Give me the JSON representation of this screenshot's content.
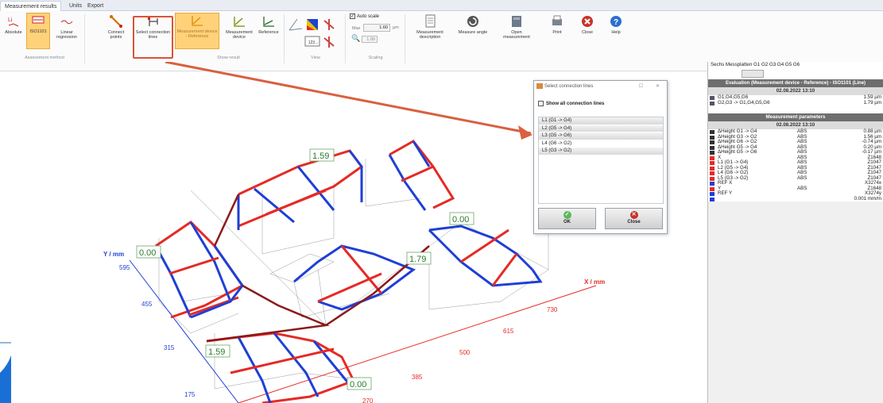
{
  "tabs": [
    "Measurement results",
    "Units",
    "Export"
  ],
  "ribbon": {
    "abs": "Absolute",
    "iso": "ISO1101",
    "linreg": "Linear regression",
    "connect": "Connect points",
    "select": "Select connection lines",
    "md_ref": "Measurement device - Reference",
    "md": "Measurement device",
    "ref": "Reference",
    "num": "123...",
    "autoscale": "Auto scale",
    "max_label": "Max",
    "max_val": "1.60",
    "max_unit": "µm",
    "min_val": "1.00",
    "mdesc": "Measurement description",
    "mangle": "Measure angle",
    "openm": "Open measurement",
    "print": "Print",
    "close": "Close",
    "help": "Help",
    "g_method": "Assessment method",
    "g_show": "Show result",
    "g_view": "View",
    "g_scaling": "Scaling"
  },
  "dialog": {
    "title": "Select connection lines",
    "showall": "Show all connection lines",
    "items": [
      "L1 (G1 -> G4)",
      "L2 (G5 -> G4)",
      "L3 (G5 -> G6)",
      "L4 (G6 -> G2)",
      "L5 (G3 -> G2)"
    ],
    "ok": "OK",
    "close": "Close"
  },
  "panel": {
    "tabs": "Sechs Messplatten  G1   G2   G3   G4   G5   G6",
    "eval_title": "Evaluation (Measurement device - Reference) - ISO1101 (Line)",
    "date": "02.08.2022 13:10",
    "eval_rows": [
      {
        "name": "G1,G4,G5,G6",
        "value": "1.59 µm"
      },
      {
        "name": "G2,G3 -> G1,G4,G5,G6",
        "value": "1.79 µm"
      }
    ],
    "params_title": "Measurement parameters",
    "params_date": "02.08.2022 13:10",
    "params": [
      {
        "name": "ΔHeight G1 -> G4",
        "mode": "ABS",
        "value": "0.88 µm"
      },
      {
        "name": "ΔHeight G3 -> G2",
        "mode": "ABS",
        "value": "1.56 µm"
      },
      {
        "name": "ΔHeight G6 -> G2",
        "mode": "ABS",
        "value": "-0.74 µm"
      },
      {
        "name": "ΔHeight G5 -> G4",
        "mode": "ABS",
        "value": "0.20 µm"
      },
      {
        "name": "ΔHeight G5 -> G6",
        "mode": "ABS",
        "value": "-0.17 µm"
      },
      {
        "name": "X",
        "mode": "ABS",
        "value": "Z1648"
      },
      {
        "name": "L1 (G1 -> G4)",
        "mode": "ABS",
        "value": "Z1047"
      },
      {
        "name": "L2 (G5 -> G4)",
        "mode": "ABS",
        "value": "Z1047"
      },
      {
        "name": "L4 (G6 -> G2)",
        "mode": "ABS",
        "value": "Z1047"
      },
      {
        "name": "L5 (G3 -> G2)",
        "mode": "ABS",
        "value": "Z1047"
      },
      {
        "name": "REF X",
        "mode": "",
        "value": "X3274x"
      },
      {
        "name": "Y",
        "mode": "ABS",
        "value": "Z1648"
      },
      {
        "name": "REF Y",
        "mode": "",
        "value": "X3274y"
      },
      {
        "name": "",
        "mode": "",
        "value": "0.001 mm/m"
      }
    ]
  },
  "plot": {
    "y_label": "Y / mm",
    "x_label": "X / mm",
    "y_ticks": [
      "595",
      "455",
      "315",
      "175"
    ],
    "x_ticks": [
      "270",
      "385",
      "500",
      "615",
      "730"
    ],
    "values": [
      "1.59",
      "0.00",
      "0.00",
      "1.79",
      "1.59",
      "0.00"
    ]
  },
  "colors": {
    "red": "#e52a25",
    "blue": "#1f3fd6",
    "darkred": "#8b1a1a",
    "green": "#2a7a2a",
    "arrow": "#d9603f"
  }
}
